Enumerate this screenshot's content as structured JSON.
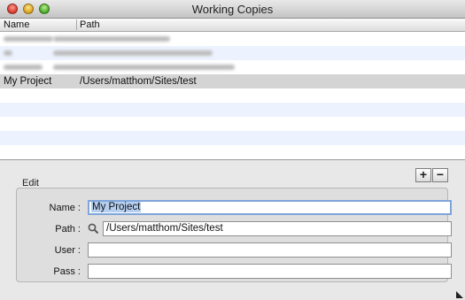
{
  "window": {
    "title": "Working Copies"
  },
  "table": {
    "columns": [
      "Name",
      "Path"
    ],
    "rows": [
      {
        "name": "",
        "path": "",
        "redacted": true
      },
      {
        "name": "",
        "path": "",
        "redacted": true
      },
      {
        "name": "",
        "path": "",
        "redacted": true
      },
      {
        "name": "My Project",
        "path": "/Users/matthom/Sites/test",
        "selected": true
      },
      {
        "name": "",
        "path": ""
      },
      {
        "name": "",
        "path": ""
      },
      {
        "name": "",
        "path": ""
      },
      {
        "name": "",
        "path": ""
      },
      {
        "name": "",
        "path": ""
      }
    ]
  },
  "toolbar": {
    "add_label": "+",
    "remove_label": "−"
  },
  "edit": {
    "group_label": "Edit",
    "name_label": "Name :",
    "name_value": "My Project",
    "path_label": "Path :",
    "path_value": "/Users/matthom/Sites/test",
    "user_label": "User :",
    "user_value": "",
    "pass_label": "Pass :",
    "pass_value": ""
  },
  "icons": {
    "path_field": "magnifier-icon",
    "resize": "resize-grip-icon"
  },
  "colors": {
    "selected_row": "#d4d4d4",
    "alt_row": "#edf3fe",
    "focus_ring": "#7fa5db",
    "text_selection": "#b5cff0"
  }
}
